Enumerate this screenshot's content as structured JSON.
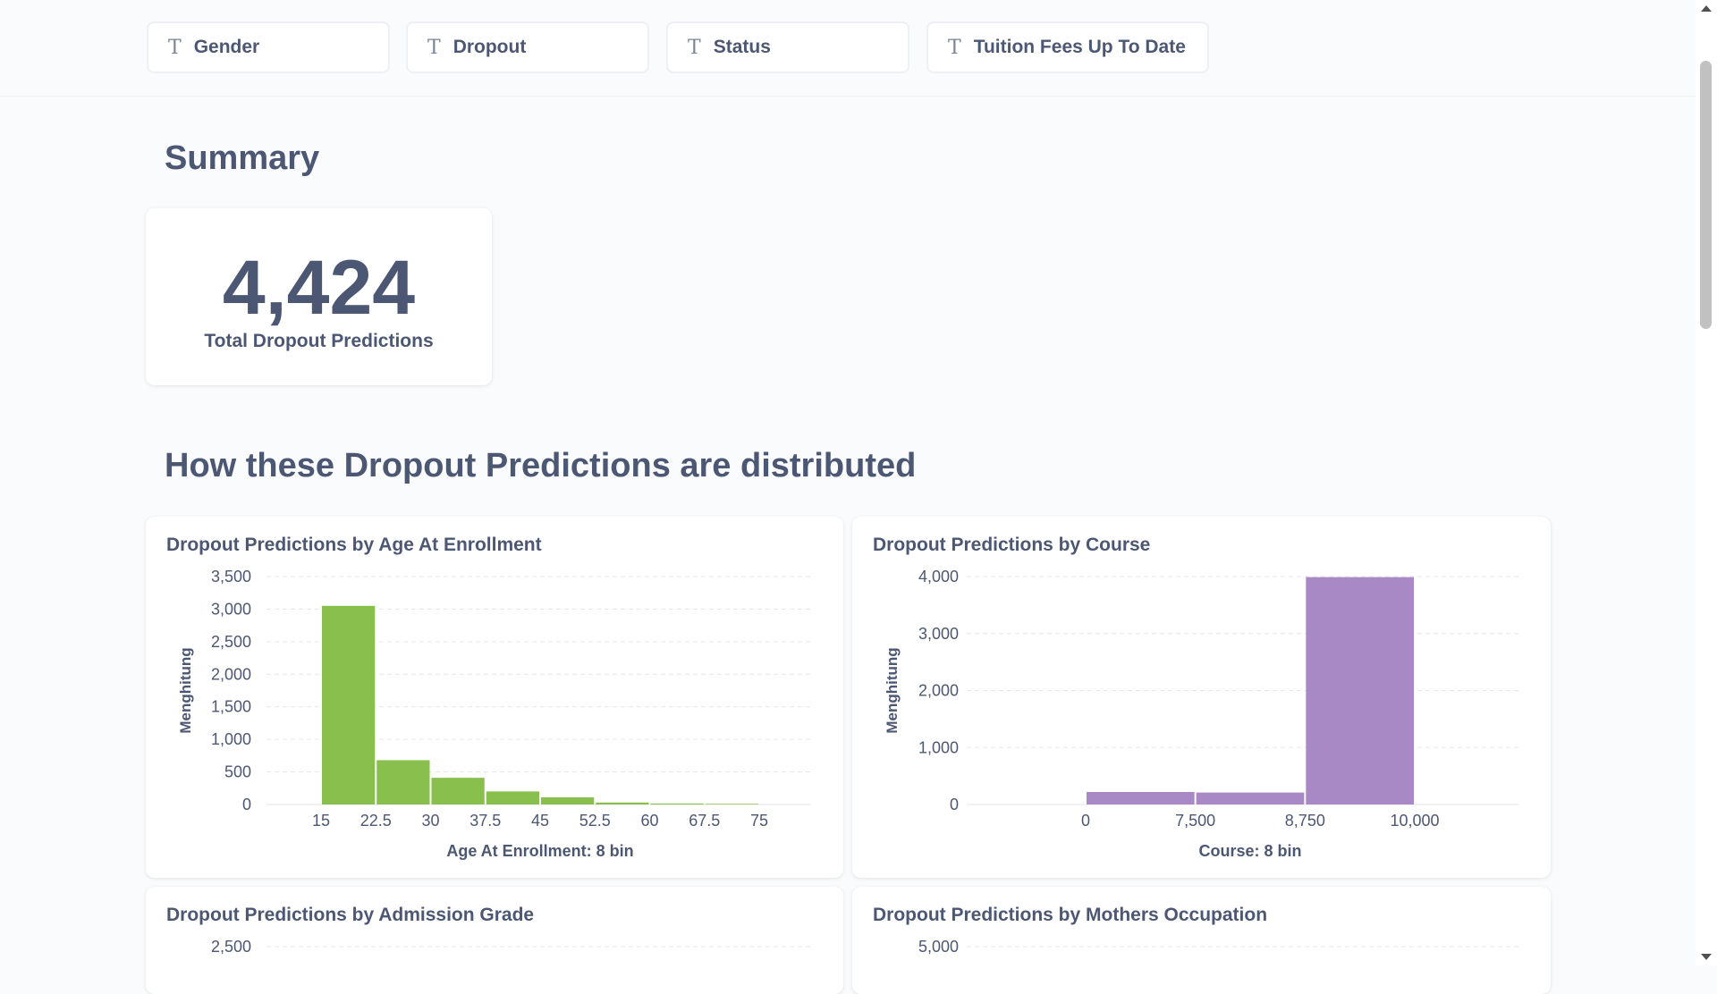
{
  "filters": [
    {
      "label": "Gender",
      "icon": "text-type-icon"
    },
    {
      "label": "Dropout",
      "icon": "text-type-icon"
    },
    {
      "label": "Status",
      "icon": "text-type-icon"
    },
    {
      "label": "Tuition Fees Up To Date",
      "icon": "text-type-icon"
    }
  ],
  "filter_icon_glyph": "T",
  "summary_heading": "Summary",
  "kpi": {
    "value": "4,424",
    "label": "Total Dropout Predictions"
  },
  "distribution_heading": "How these Dropout Predictions are distributed",
  "chart_data": [
    {
      "type": "bar",
      "title": "Dropout Predictions by Age At Enrollment",
      "xlabel": "Age At Enrollment: 8 bin",
      "ylabel": "Menghitung",
      "color": "#88bf4d",
      "x_ticks": [
        15,
        22.5,
        30,
        37.5,
        45,
        52.5,
        60,
        67.5,
        75
      ],
      "x_tick_labels": [
        "15",
        "22.5",
        "30",
        "37.5",
        "45",
        "52.5",
        "60",
        "67.5",
        "75"
      ],
      "bins": [
        [
          15,
          22.5
        ],
        [
          22.5,
          30
        ],
        [
          30,
          37.5
        ],
        [
          37.5,
          45
        ],
        [
          45,
          52.5
        ],
        [
          52.5,
          60
        ],
        [
          60,
          67.5
        ],
        [
          67.5,
          75
        ]
      ],
      "values": [
        3050,
        680,
        410,
        200,
        110,
        30,
        15,
        10
      ],
      "y_ticks": [
        0,
        500,
        1000,
        1500,
        2000,
        2500,
        3000,
        3500
      ],
      "y_tick_labels": [
        "0",
        "500",
        "1,000",
        "1,500",
        "2,000",
        "2,500",
        "3,000",
        "3,500"
      ],
      "ylim": [
        0,
        3500
      ],
      "grid": true
    },
    {
      "type": "bar",
      "title": "Dropout Predictions by Course",
      "xlabel": "Course: 8 bin",
      "ylabel": "Menghitung",
      "color": "#a989c5",
      "x_ticks": [
        0,
        1,
        2,
        3
      ],
      "x_tick_labels": [
        "0",
        "7,500",
        "8,750",
        "10,000"
      ],
      "bins": [
        [
          0,
          1
        ],
        [
          1,
          2
        ],
        [
          2,
          3
        ]
      ],
      "values": [
        220,
        210,
        3990
      ],
      "y_ticks": [
        0,
        1000,
        2000,
        3000,
        4000
      ],
      "y_tick_labels": [
        "0",
        "1,000",
        "2,000",
        "3,000",
        "4,000"
      ],
      "ylim": [
        0,
        4000
      ],
      "grid": true
    },
    {
      "type": "bar",
      "title": "Dropout Predictions by Admission Grade",
      "y_ticks": [
        2500
      ],
      "y_tick_labels": [
        "2,500"
      ]
    },
    {
      "type": "bar",
      "title": "Dropout Predictions by Mothers Occupation",
      "y_ticks": [
        5000
      ],
      "y_tick_labels": [
        "5,000"
      ]
    }
  ]
}
